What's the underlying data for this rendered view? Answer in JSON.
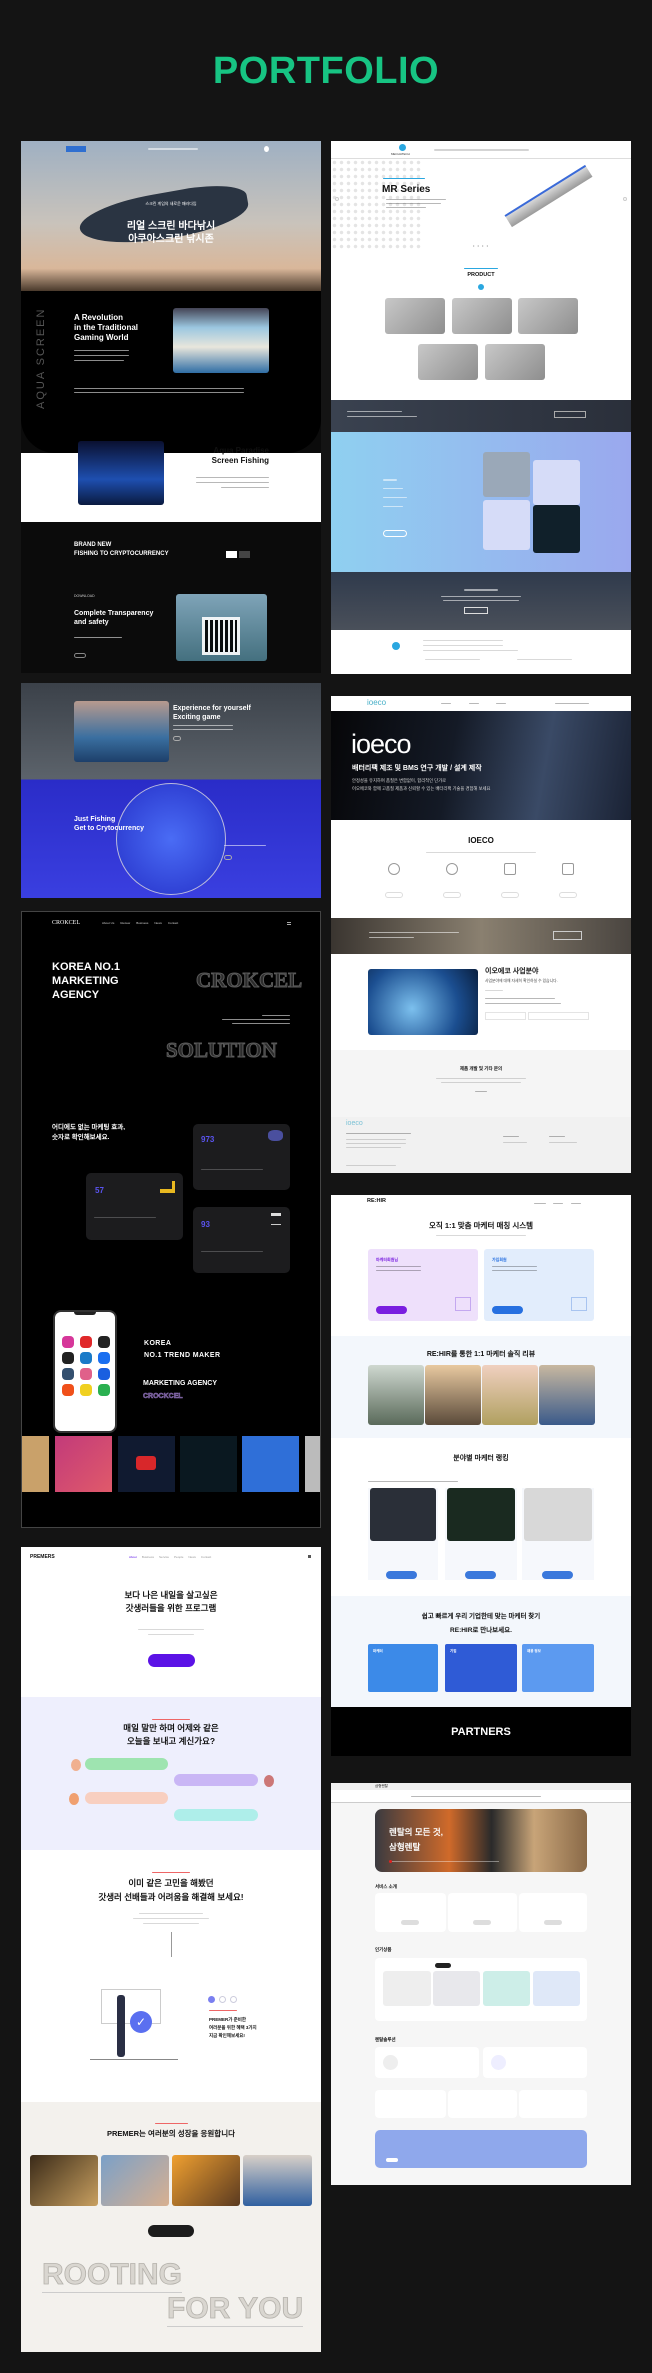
{
  "page": {
    "title": "PORTFOLIO",
    "accent": "#17c483",
    "background": "#141414"
  },
  "aqua": {
    "hero_sub": "스크린 게임의 새로운 패러다임",
    "hero_title": [
      "리얼 스크린 바다낚시",
      "아쿠아스크린 낚시존"
    ],
    "side_label": "AQUA SCREEN",
    "revolution": [
      "A Revolution",
      "in the Traditional",
      "Gaming World"
    ],
    "paradise": [
      "Aqua Paradise",
      "Screen Fishing"
    ],
    "brand": [
      "BRAND NEW",
      "FISHING TO CRYPTOCURRENCY"
    ],
    "download_label": "DOWNLOAD",
    "download_title": [
      "Complete Transparency",
      "and safety"
    ],
    "experience": [
      "Experience for yourself",
      "Exciting game"
    ],
    "just": [
      "Just Fishing",
      "Get to Crytocurrency"
    ]
  },
  "mechatech": {
    "logo": "MECHATECH",
    "series": "MR Series",
    "product": "PRODUCT",
    "brand_color": "#2aa7e0"
  },
  "ioeco": {
    "logo": "ioeco",
    "hero_title": "배터리팩 제조 및 BMS 연구 개발 / 설계 제작",
    "hero_lines": [
      "안정성을 유지하며 품질은 변함없이, 합리적인 단가로",
      "이오에코와 함께 고품질 제품과 신뢰할 수 있는 배터리팩 기술을 경험해 보세요"
    ],
    "section_title": "IOECO",
    "biz_title": "이오에코 사업분야",
    "biz_sub": "사업분야에 대해 자세히 확인하실 수 있습니다.",
    "contact_title": "제품 개발 및 기타 문의",
    "icons": [
      "globe-icon",
      "gear-icon",
      "document-icon",
      "chat-icon"
    ]
  },
  "crokcel": {
    "logo": "CROKCEL",
    "nav": [
      "About Us",
      "Review",
      "Business",
      "News",
      "Contact"
    ],
    "hero": [
      "KOREA NO.1",
      "MARKETING",
      "AGENCY"
    ],
    "outline_1": "CROKCEL",
    "outline_2": "SOLUTION",
    "stats_heading": [
      "어디에도 없는 마케팅 효과,",
      "숫자로 확인해보세요."
    ],
    "stats": [
      {
        "value": "973"
      },
      {
        "value": "57"
      },
      {
        "value": "93"
      }
    ],
    "trend": [
      "KOREA",
      "NO.1 TREND MAKER"
    ],
    "agency": "MARKETING AGENCY",
    "agency_outline": "CROCKCEL",
    "app_icons": [
      "instagram-icon",
      "youtube-icon",
      "x-icon",
      "tiktok-icon",
      "linkedin-icon",
      "facebook-icon",
      "tumblr-icon",
      "dribbble-icon",
      "behance-icon",
      "reddit-icon",
      "snapchat-icon",
      "line-icon"
    ]
  },
  "premer": {
    "logo": "PREMERS",
    "nav": [
      "About",
      "Business",
      "Service",
      "People",
      "News",
      "Contact"
    ],
    "headline": [
      "보다 나은 내일을 살고싶은",
      "갓생러들을 위한 프로그램"
    ],
    "section2": [
      "매일 말만 하며 어제와 같은",
      "오늘을 보내고 계신가요?"
    ],
    "section3": [
      "이미 같은 고민을 해봤던",
      "갓생러 선배들과 어려움을 해결해 보세요!"
    ],
    "benefits": [
      "PREMER가 준비한",
      "여러분을 위한 혜택 3가지",
      "지금 확인해보세요!"
    ],
    "section4": "PREMER는 여러분의 성장을 응원합니다",
    "rooting": "ROOTING",
    "for_you": "FOR YOU",
    "accent": "#5b12e6"
  },
  "rehir": {
    "logo": "RE:HIR",
    "headline": "오직 1:1 맞춤 마케터 매칭 시스템",
    "cards": [
      "마케터회원님",
      "가입회원"
    ],
    "reviews_title": "RE:HIR를 통한 1:1 마케터 솔직 리뷰",
    "ranking_title": "분야별 마케터 랭킹",
    "find_title": [
      "쉽고 빠르게 우리 기업한테 맞는 마케터 찾기",
      "RE:HIR로 만나보세요."
    ],
    "find_cards": [
      "마케터",
      "기업",
      "채용 정보"
    ],
    "partners": "PARTNERS"
  },
  "rental": {
    "logo": "삼형렌탈",
    "hero": [
      "렌탈의 모든 것,",
      "삼형렌탈"
    ],
    "services_title": "서비스 소개",
    "popular_title": "인기상품",
    "solutions_title": "렌탈솔루션"
  }
}
